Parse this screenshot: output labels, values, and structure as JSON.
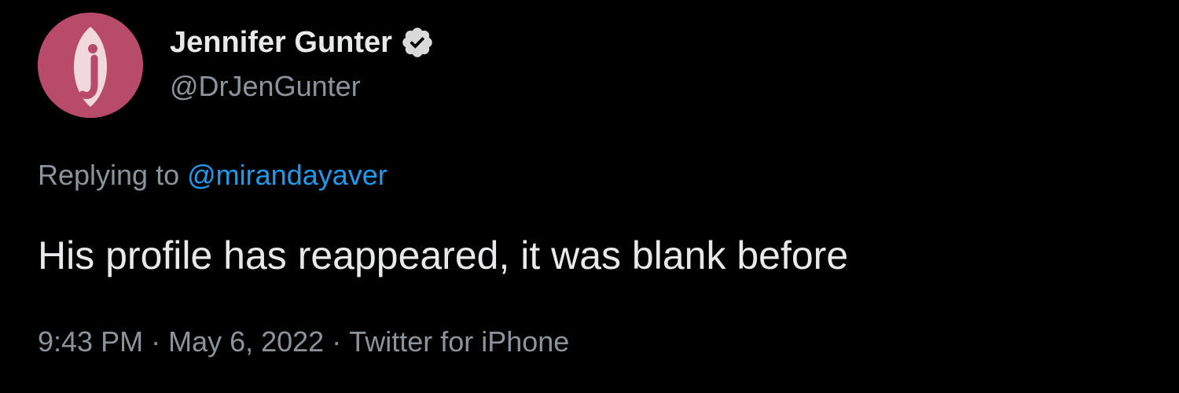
{
  "author": {
    "display_name": "Jennifer Gunter",
    "handle": "@DrJenGunter",
    "verified_icon": "verified-badge-icon",
    "avatar_letter": "j",
    "avatar_color": "#b94b6a"
  },
  "reply": {
    "prefix": "Replying to",
    "target": "@mirandayaver"
  },
  "tweet": {
    "text": "His profile has reappeared, it was blank before"
  },
  "meta": {
    "time": "9:43 PM",
    "separator": "·",
    "date": "May 6, 2022",
    "source": "Twitter for iPhone"
  },
  "colors": {
    "background": "#000000",
    "primary_text": "#e7e9ea",
    "secondary_text": "#8b949a",
    "link": "#1d9bf0"
  }
}
